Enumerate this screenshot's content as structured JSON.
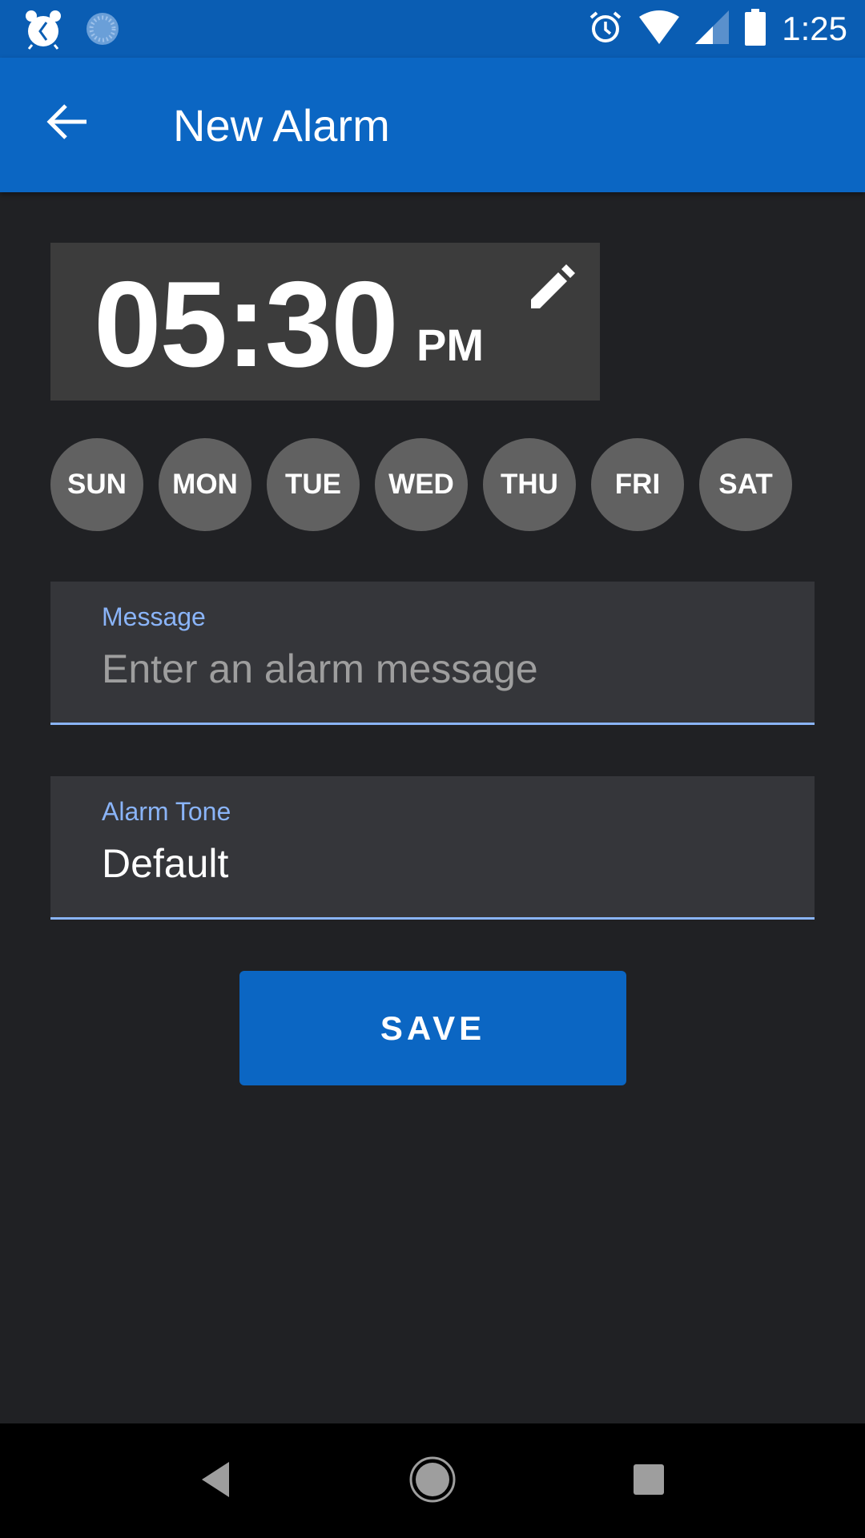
{
  "status_bar": {
    "left_icons": [
      "alarm-clock-app-icon",
      "sync-spinner-icon"
    ],
    "right_icons": [
      "alarm-icon",
      "wifi-icon",
      "cell-signal-icon",
      "battery-icon"
    ],
    "time": "1:25"
  },
  "app_bar": {
    "back_icon": "arrow-back-icon",
    "title": "New Alarm",
    "color": "#0b66c3"
  },
  "time_picker": {
    "time": "05:30",
    "period": "PM",
    "edit_icon": "pencil-icon"
  },
  "days": [
    {
      "label": "SUN",
      "selected": false
    },
    {
      "label": "MON",
      "selected": false
    },
    {
      "label": "TUE",
      "selected": false
    },
    {
      "label": "WED",
      "selected": false
    },
    {
      "label": "THU",
      "selected": false
    },
    {
      "label": "FRI",
      "selected": false
    },
    {
      "label": "SAT",
      "selected": false
    }
  ],
  "message_field": {
    "label": "Message",
    "value": "",
    "placeholder": "Enter an alarm message"
  },
  "tone_field": {
    "label": "Alarm Tone",
    "value": "Default"
  },
  "save_button": {
    "label": "SAVE"
  },
  "nav_bar": {
    "icons": [
      "nav-back-icon",
      "nav-home-icon",
      "nav-recents-icon"
    ]
  },
  "colors": {
    "accent": "#0b66c3",
    "status_bar": "#0a5db3",
    "background": "#202124",
    "field_label": "#8ab4f8",
    "day_chip": "#616161"
  }
}
